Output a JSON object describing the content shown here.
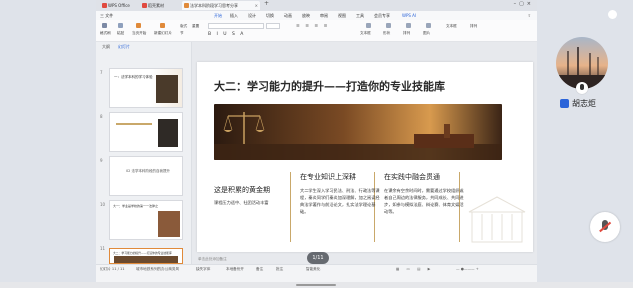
{
  "tabs": [
    {
      "label": "WPS Office",
      "color": "#e04a3f"
    },
    {
      "label": "稻壳素材",
      "color": "#e04a3f"
    },
    {
      "label": "法学本科阶段学习思考分享",
      "color": "#e08a3a"
    }
  ],
  "menu": [
    "三 文件",
    "开始",
    "插入",
    "设计",
    "切换",
    "动画",
    "放映",
    "审阅",
    "视图",
    "工具",
    "会员专享",
    "WPS AI"
  ],
  "toolbar": {
    "items": [
      "格式刷",
      "粘贴",
      "当页开始",
      "新建幻灯片",
      "版式",
      "节",
      "重置",
      "文本框",
      "形状",
      "排列",
      "图片",
      "文本框",
      "排列"
    ]
  },
  "outline": {
    "tab_outline": "大纲",
    "tab_slides": "幻灯片",
    "thumbs": [
      {
        "num": "7",
        "text": "一：法学本科的学习体验"
      },
      {
        "num": "8",
        "text": ""
      },
      {
        "num": "9",
        "text": "02 法学本科阶段的自我提升"
      },
      {
        "num": "10",
        "text": "大一：学业是学校的第一一法律之"
      },
      {
        "num": "11",
        "text": "大二：学习能力的提升——打造你的专业技能库"
      }
    ],
    "add": "+"
  },
  "slide": {
    "title": "大二：学习能力的提升——打造你的专业技能库",
    "col1": {
      "title": "这是积累的黄金期",
      "body": "课程压力适中、社团活动丰富"
    },
    "col2": {
      "title": "在专业知识上深耕",
      "body": "大二学生深入学习民法、刑法、行政法等课程，秦炎同学们秦炎加深理解，加之阅读经典法学著作与前沿论文，扎实法学理论基础。"
    },
    "col3": {
      "title": "在实践中融会贯通",
      "body": "在课余有空余时间时，需要通过学校组织或者自己周边的法律服务，共同成长、共同进步，如参与模拟法庭、辩论赛、体育文娱活动等。"
    }
  },
  "notes": "单击此处添加备注",
  "pager": "1/11",
  "status": {
    "left": "幻灯片 11 / 11",
    "template": "城市地铁系列的办公商务风",
    "mid1": "缺失字体",
    "mid2": "本地备份开",
    "mid3": "备注",
    "mid4": "批注",
    "right": "智能美化"
  },
  "participant": {
    "name": "胡志炬"
  }
}
